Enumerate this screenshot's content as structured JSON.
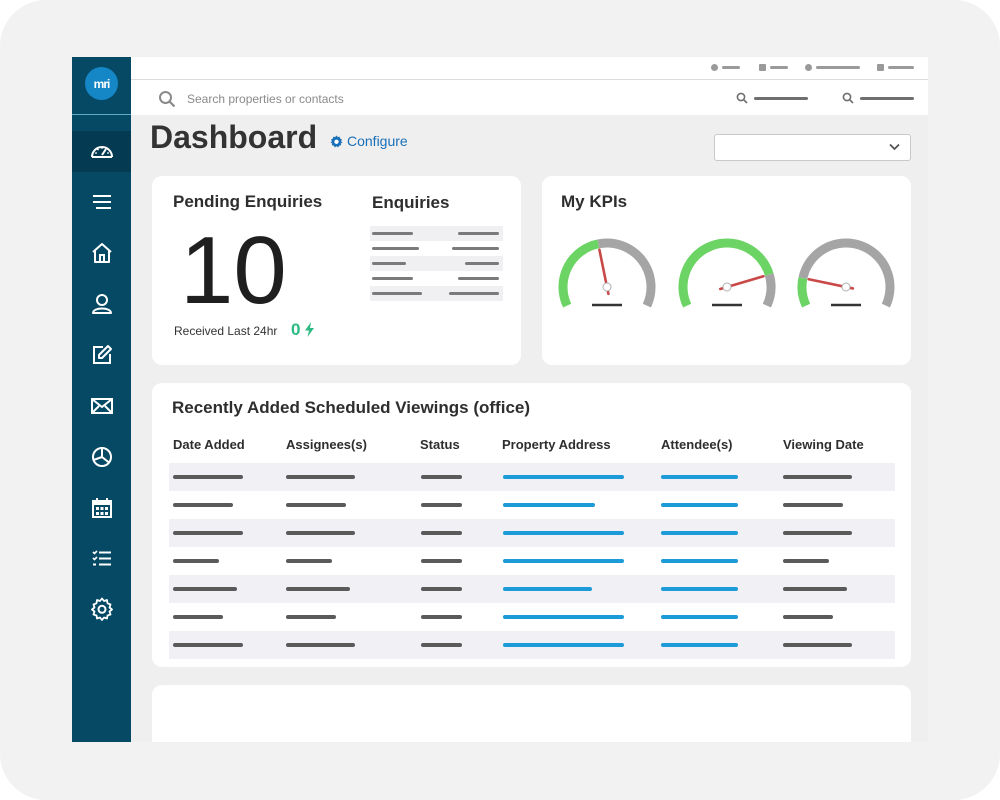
{
  "app": {
    "logo_text": "mri"
  },
  "search": {
    "placeholder": "Search properties or contacts"
  },
  "header": {
    "title": "Dashboard",
    "configure_label": "Configure"
  },
  "pending": {
    "title": "Pending Enquiries",
    "count": "10",
    "received_label": "Received Last 24hr",
    "received_count": "0"
  },
  "enquiries": {
    "title": "Enquiries"
  },
  "kpis": {
    "title": "My KPIs",
    "gauges": [
      {
        "name": "kpi-gauge-1",
        "value": 0.45,
        "color": "#6bd465"
      },
      {
        "name": "kpi-gauge-2",
        "value": 0.82,
        "color": "#6bd465"
      },
      {
        "name": "kpi-gauge-3",
        "value": 0.16,
        "color": "#6bd465"
      }
    ]
  },
  "viewings": {
    "title": "Recently Added Scheduled Viewings (office)",
    "columns": [
      "Date Added",
      "Assignees(s)",
      "Status",
      "Property Address",
      "Attendee(s)",
      "Viewing Date"
    ]
  },
  "colors": {
    "sidebar": "#064965",
    "accent": "#1a70b8",
    "link": "#1c9bd8",
    "success": "#2cb982",
    "gauge_green": "#6bd465",
    "gauge_grey": "#a5a5a5",
    "needle": "#c94848"
  }
}
